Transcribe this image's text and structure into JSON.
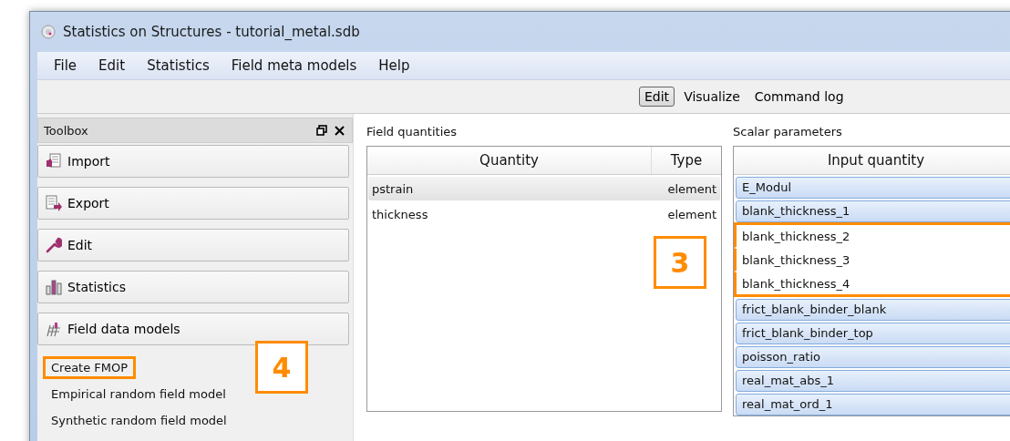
{
  "window": {
    "title": "Statistics on Structures - tutorial_metal.sdb"
  },
  "menu": [
    "File",
    "Edit",
    "Statistics",
    "Field meta models",
    "Help"
  ],
  "view_tabs": [
    {
      "label": "Edit",
      "selected": true
    },
    {
      "label": "Visualize",
      "selected": false
    },
    {
      "label": "Command log",
      "selected": false
    }
  ],
  "toolbox": {
    "title": "Toolbox",
    "sections": [
      {
        "label": "Import",
        "kind": "import"
      },
      {
        "label": "Export",
        "kind": "export"
      },
      {
        "label": "Edit",
        "kind": "edit"
      },
      {
        "label": "Statistics",
        "kind": "statistics"
      },
      {
        "label": "Field data models",
        "kind": "fielddata"
      }
    ],
    "actions": [
      {
        "label": "Create FMOP",
        "highlighted": true
      },
      {
        "label": "Empirical random field model",
        "highlighted": false
      },
      {
        "label": "Synthetic random field model",
        "highlighted": false
      }
    ]
  },
  "field_quantities": {
    "title": "Field quantities",
    "columns": [
      "Quantity",
      "Type"
    ],
    "rows": [
      {
        "quantity": "pstrain",
        "type": "element",
        "selected": true
      },
      {
        "quantity": "thickness",
        "type": "element",
        "selected": false
      }
    ]
  },
  "scalar_parameters": {
    "title": "Scalar parameters",
    "columns": [
      "Input quantity"
    ],
    "rows": [
      {
        "name": "E_Modul",
        "selected": true,
        "highlighted": false
      },
      {
        "name": "blank_thickness_1",
        "selected": true,
        "highlighted": false
      },
      {
        "name": "blank_thickness_2",
        "selected": false,
        "highlighted": true
      },
      {
        "name": "blank_thickness_3",
        "selected": false,
        "highlighted": true
      },
      {
        "name": "blank_thickness_4",
        "selected": false,
        "highlighted": true
      },
      {
        "name": "frict_blank_binder_blank",
        "selected": true,
        "highlighted": false
      },
      {
        "name": "frict_blank_binder_top",
        "selected": true,
        "highlighted": false
      },
      {
        "name": "poisson_ratio",
        "selected": true,
        "highlighted": false
      },
      {
        "name": "real_mat_abs_1",
        "selected": true,
        "highlighted": false
      },
      {
        "name": "real_mat_ord_1",
        "selected": true,
        "highlighted": false
      }
    ]
  },
  "callouts": [
    {
      "label": "3",
      "kind": "fields"
    },
    {
      "label": "4",
      "kind": "toolbox"
    }
  ]
}
